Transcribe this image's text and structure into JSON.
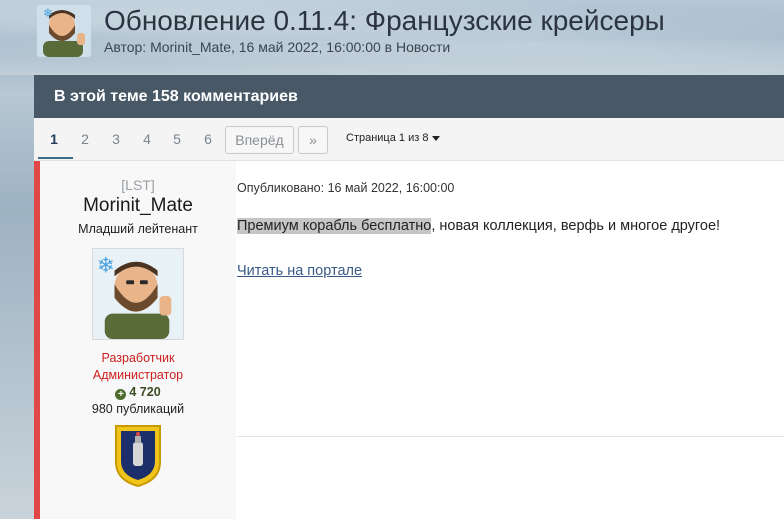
{
  "topic": {
    "title": "Обновление 0.11.4: Французские крейсеры",
    "meta": "Автор: Morinit_Mate, 16 май 2022, 16:00:00 в Новости"
  },
  "panel": {
    "header": "В этой теме 158 комментариев"
  },
  "pager": {
    "pages": [
      "1",
      "2",
      "3",
      "4",
      "5",
      "6"
    ],
    "active_page": "1",
    "next_label": "Вперёд",
    "last_label": "»",
    "indicator": "Страница 1 из 8"
  },
  "post": {
    "author": {
      "tag": "[LST]",
      "name": "Morinit_Mate",
      "rank": "Младший лейтенант",
      "groups": [
        "Разработчик",
        "Администратор"
      ],
      "reputation": "4 720",
      "publications": "980 публикаций"
    },
    "date": "Опубликовано: 16 май 2022, 16:00:00",
    "text_highlight": "Премиум корабль бесплатно",
    "text_rest": ", новая коллекция, верфь и многое другое!",
    "link": "Читать на портале"
  },
  "colors": {
    "header_bg": "#485867",
    "accent_red": "#e04848",
    "group_red": "#cc1f1f",
    "link_blue": "#3a5a85"
  },
  "icons": {
    "avatar": "bearded-man-thumbs-up",
    "snowflake": "snowflake-icon",
    "badge": "clan-shield-badge"
  }
}
